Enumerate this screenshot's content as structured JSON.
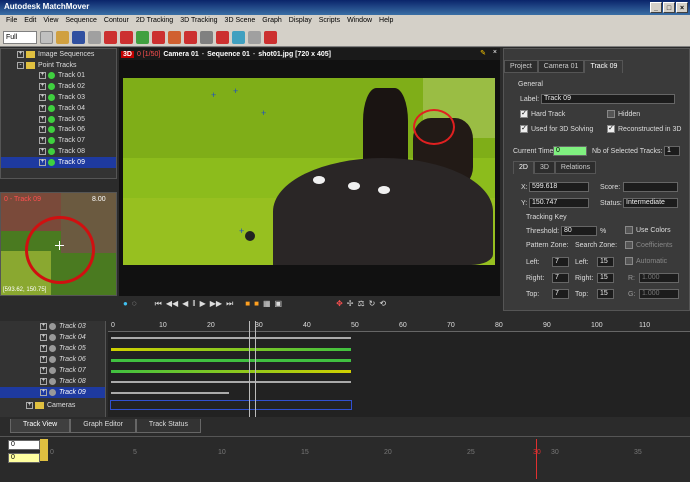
{
  "window": {
    "title": "Autodesk MatchMover"
  },
  "menu": [
    "File",
    "Edit",
    "View",
    "Sequence",
    "Contour",
    "2D Tracking",
    "3D Tracking",
    "3D Scene",
    "Graph",
    "Display",
    "Scripts",
    "Window",
    "Help"
  ],
  "toolbar": {
    "mode": "Full"
  },
  "tree": {
    "sections": [
      "Image Sequences",
      "Point Tracks"
    ],
    "tracks": [
      "Track 01",
      "Track 02",
      "Track 03",
      "Track 04",
      "Track 05",
      "Track 06",
      "Track 07",
      "Track 08",
      "Track 09"
    ],
    "selected": "Track 09"
  },
  "zoom": {
    "label": "0 - Track 09",
    "value": "8.00",
    "coords": "[593.62, 150.75]"
  },
  "viewer": {
    "badge": "3D",
    "frame": "0 [1/50]",
    "camera": "Camera 01",
    "sequence": "Sequence 01",
    "file": "shot01.jpg [720 x 405]"
  },
  "panel": {
    "tabs": [
      "Project",
      "Camera 01",
      "Track 09"
    ],
    "general": "General",
    "label_caption": "Label:",
    "label_value": "Track 09",
    "hard_track": "Hard Track",
    "hidden": "Hidden",
    "used_3d": "Used for 3D Solving",
    "reconstructed": "Reconstructed in 3D",
    "current_time_caption": "Current Time:",
    "current_time": "0",
    "nb_selected_caption": "Nb of Selected Tracks:",
    "nb_selected": "1",
    "subtabs": [
      "2D",
      "3D",
      "Relations"
    ],
    "x_caption": "X:",
    "x": "599.618",
    "y_caption": "Y:",
    "y": "150.747",
    "score_caption": "Score:",
    "status_caption": "Status:",
    "status": "Intermediate",
    "tracking_key": "Tracking Key",
    "threshold_caption": "Threshold:",
    "threshold": "80",
    "threshold_unit": "%",
    "use_colors": "Use Colors",
    "coefficients": "Coefficients",
    "automatic": "Automatic",
    "pattern_zone": "Pattern Zone:",
    "search_zone": "Search Zone:",
    "left_caption": "Left:",
    "right_caption": "Right:",
    "top_caption": "Top:",
    "pattern_left": "7",
    "pattern_right": "7",
    "pattern_top": "7",
    "search_left": "15",
    "search_right": "15",
    "search_top": "15",
    "r_caption": "R:",
    "g_caption": "G:",
    "r_value": "1.000",
    "g_value": "1.000"
  },
  "timeline": {
    "tracks": [
      "Track 03",
      "Track 04",
      "Track 05",
      "Track 06",
      "Track 07",
      "Track 08",
      "Track 09"
    ],
    "bottom_item": "Cameras",
    "ticks": [
      "0",
      "10",
      "20",
      "30",
      "40",
      "50",
      "60",
      "70",
      "80",
      "90",
      "100",
      "110"
    ],
    "tabs": [
      "Track View",
      "Graph Editor",
      "Track Status"
    ],
    "range_start": "0",
    "current": "0",
    "ruler": [
      "0",
      "5",
      "10",
      "15",
      "20",
      "25",
      "30",
      "35"
    ],
    "marker": "30"
  },
  "colors": {
    "accent": "#1e3aa0",
    "green_screen": "#8cbc1c",
    "title": "#0a246a"
  }
}
